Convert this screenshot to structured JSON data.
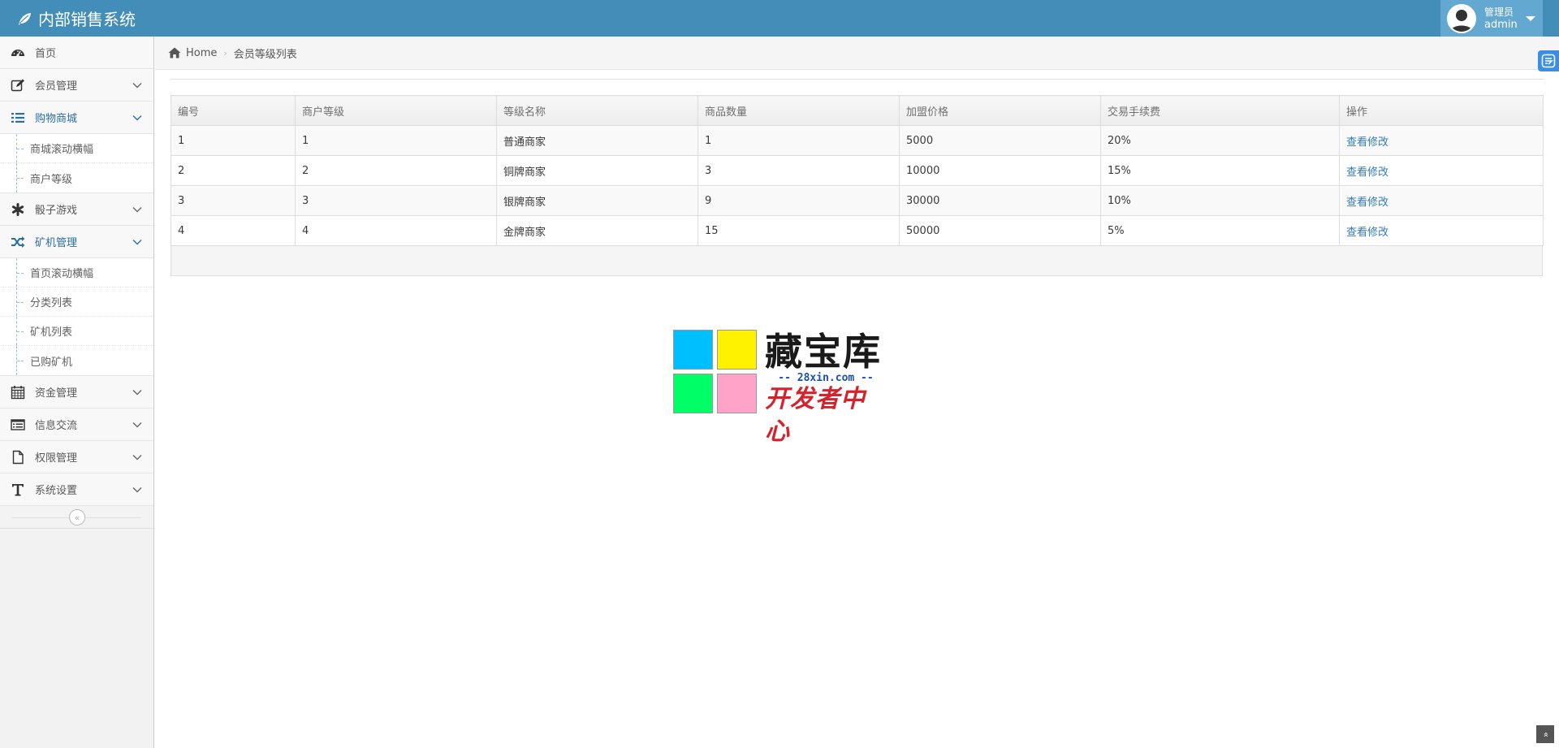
{
  "app": {
    "title": "内部销售系统"
  },
  "user": {
    "role": "管理员",
    "name": "admin"
  },
  "sidebar": {
    "items": [
      {
        "label": "首页",
        "icon": "dashboard-icon"
      },
      {
        "label": "会员管理",
        "icon": "edit-icon"
      },
      {
        "label": "购物商城",
        "icon": "list-icon",
        "open": true,
        "children": [
          "商城滚动横幅",
          "商户等级"
        ]
      },
      {
        "label": "骰子游戏",
        "icon": "asterisk-icon"
      },
      {
        "label": "矿机管理",
        "icon": "random-icon",
        "open": true,
        "children": [
          "首页滚动横幅",
          "分类列表",
          "矿机列表",
          "已购矿机"
        ]
      },
      {
        "label": "资金管理",
        "icon": "calendar-icon"
      },
      {
        "label": "信息交流",
        "icon": "list-alt-icon"
      },
      {
        "label": "权限管理",
        "icon": "file-icon"
      },
      {
        "label": "系统设置",
        "icon": "text-icon"
      }
    ],
    "collapse_glyph": "«"
  },
  "breadcrumb": {
    "home": "Home",
    "current": "会员等级列表"
  },
  "table": {
    "columns": [
      "编号",
      "商户等级",
      "等级名称",
      "商品数量",
      "加盟价格",
      "交易手续费",
      "操作"
    ],
    "rows": [
      {
        "id": "1",
        "level": "1",
        "name": "普通商家",
        "count": "1",
        "price": "5000",
        "fee": "20%",
        "action": "查看修改"
      },
      {
        "id": "2",
        "level": "2",
        "name": "铜牌商家",
        "count": "3",
        "price": "10000",
        "fee": "15%",
        "action": "查看修改"
      },
      {
        "id": "3",
        "level": "3",
        "name": "银牌商家",
        "count": "9",
        "price": "30000",
        "fee": "10%",
        "action": "查看修改"
      },
      {
        "id": "4",
        "level": "4",
        "name": "金牌商家",
        "count": "15",
        "price": "50000",
        "fee": "5%",
        "action": "查看修改"
      }
    ]
  },
  "watermark": {
    "title": "藏宝库",
    "url": "-- 28xin.com --",
    "subtitle": "开发者中心",
    "colors": [
      "#00bfff",
      "#fff200",
      "#00ff66",
      "#ffa3c8"
    ]
  },
  "colors": {
    "navbar": "#438eb9",
    "user_box": "#62a8d1",
    "link": "#337ab7",
    "active_menu": "#2b6ea3"
  },
  "back_to_top_glyph": "»"
}
